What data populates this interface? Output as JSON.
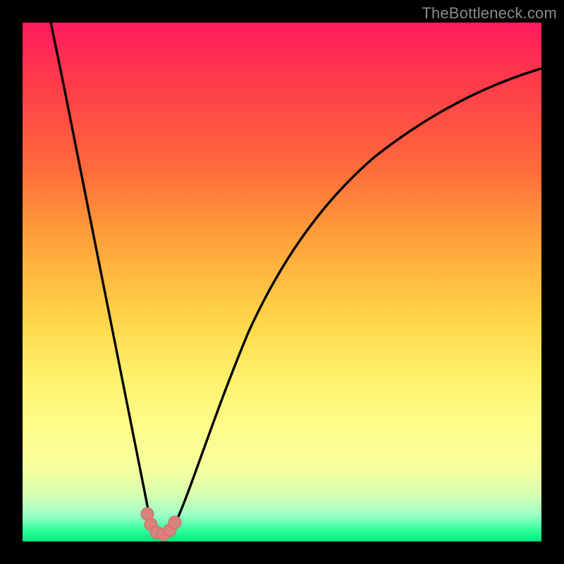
{
  "attribution": "TheBottleneck.com",
  "colors": {
    "frame": "#000000",
    "attribution": "#8a8a8a",
    "curve_stroke": "#000000",
    "marker_fill": "#d9817b",
    "marker_stroke": "#c56b65"
  },
  "chart_data": {
    "type": "line",
    "title": "",
    "xlabel": "",
    "ylabel": "",
    "xlim": [
      0,
      100
    ],
    "ylim": [
      0,
      100
    ],
    "x": [
      5,
      10,
      15,
      18,
      20,
      22,
      24,
      25,
      26,
      27,
      28,
      30,
      33,
      36,
      40,
      45,
      50,
      55,
      60,
      65,
      70,
      75,
      80,
      85,
      90,
      95,
      100
    ],
    "y": [
      100,
      72,
      46,
      30,
      20,
      11,
      4,
      1,
      0,
      0,
      1,
      5,
      13,
      22,
      32,
      44,
      53,
      60,
      66,
      71,
      75,
      78,
      81,
      83,
      85,
      87,
      88
    ],
    "annotations": [
      {
        "type": "marker_cluster",
        "x_range": [
          24,
          29
        ],
        "y_range": [
          0,
          4
        ]
      }
    ]
  }
}
